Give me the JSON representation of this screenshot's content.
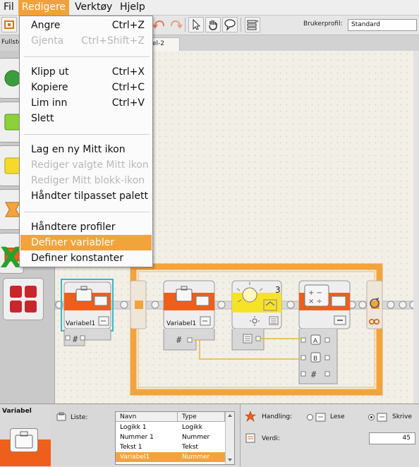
{
  "menubar": {
    "items": [
      "Fil",
      "Redigere",
      "Verktøy",
      "Hjelp"
    ],
    "active_index": 1
  },
  "toolbar": {
    "profile_label": "Brukerprofil:",
    "profile_value": "Standard"
  },
  "tabs": {
    "left_tab": "Fullste",
    "doc_tab": "el-2"
  },
  "edit_menu": {
    "items": [
      {
        "label": "Angre",
        "shortcut": "Ctrl+Z",
        "enabled": true
      },
      {
        "label": "Gjenta",
        "shortcut": "Ctrl+Shift+Z",
        "enabled": false
      },
      {
        "label": "Klipp ut",
        "shortcut": "Ctrl+X",
        "enabled": true
      },
      {
        "label": "Kopiere",
        "shortcut": "Ctrl+C",
        "enabled": true
      },
      {
        "label": "Lim inn",
        "shortcut": "Ctrl+V",
        "enabled": true
      },
      {
        "label": "Slett",
        "shortcut": "",
        "enabled": true
      },
      {
        "label": "Lag en ny Mitt ikon",
        "shortcut": "",
        "enabled": true
      },
      {
        "label": "Rediger valgte Mitt ikon",
        "shortcut": "",
        "enabled": false
      },
      {
        "label": "Rediger Mitt blokk-ikon",
        "shortcut": "",
        "enabled": false
      },
      {
        "label": "Håndter tilpasset palett",
        "shortcut": "",
        "enabled": true
      },
      {
        "label": "Håndtere profiler",
        "shortcut": "",
        "enabled": true
      },
      {
        "label": "Definer variabler",
        "shortcut": "",
        "enabled": true,
        "selected": true
      },
      {
        "label": "Definer konstanter",
        "shortcut": "",
        "enabled": true
      }
    ]
  },
  "canvas": {
    "block1_label": "Variabel1",
    "block2_label": "Variabel1",
    "sensor_port": "3",
    "math_port_a": "A",
    "math_port_b": "B"
  },
  "bottom_panel": {
    "title": "Variabel",
    "list_label": "Liste:",
    "table": {
      "headers": [
        "Navn",
        "Type"
      ],
      "rows": [
        {
          "name": "Logikk 1",
          "type": "Logikk",
          "selected": false
        },
        {
          "name": "Nummer 1",
          "type": "Nummer",
          "selected": false
        },
        {
          "name": "Tekst 1",
          "type": "Tekst",
          "selected": false
        },
        {
          "name": "Variabel1",
          "type": "Nummer",
          "selected": true
        }
      ]
    },
    "action_label": "Handling:",
    "read_label": "Lese",
    "write_label": "Skrive",
    "selected_action": "Skrive",
    "value_label": "Verdi:",
    "value": "45"
  },
  "colors": {
    "accent_orange": "#f3a33c",
    "block_orange": "#ef5f1b",
    "selection_cyan": "#3bb7c4",
    "canvas_bg": "#f2efe7"
  }
}
